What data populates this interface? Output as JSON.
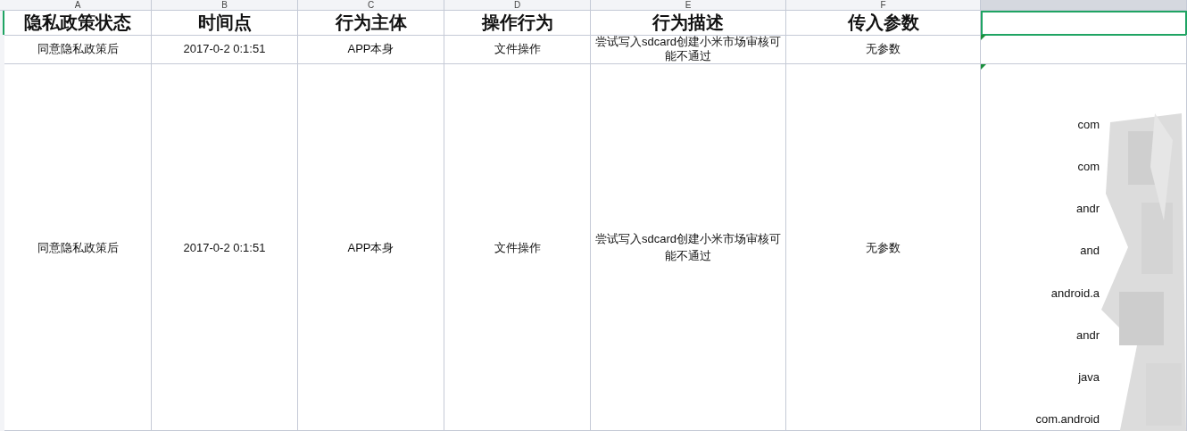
{
  "column_headers": [
    {
      "label": "A",
      "selected": false
    },
    {
      "label": "B",
      "selected": false
    },
    {
      "label": "C",
      "selected": false
    },
    {
      "label": "D",
      "selected": false
    },
    {
      "label": "E",
      "selected": false
    },
    {
      "label": "F",
      "selected": false
    },
    {
      "selected": true
    }
  ],
  "rows": [
    {
      "kind": "header",
      "cells": [
        {
          "text": "隐私政策状态",
          "selected": false
        },
        {
          "text": "时间点",
          "selected": false
        },
        {
          "text": "行为主体",
          "selected": false
        },
        {
          "text": "操作行为",
          "selected": false
        },
        {
          "text": "行为描述",
          "selected": false
        },
        {
          "text": "传入参数",
          "selected": false
        },
        {
          "selected": true
        }
      ]
    },
    {
      "kind": "data",
      "cells": [
        {
          "text": "同意隐私政策后",
          "selected": false
        },
        {
          "text": "2017-0-2 0:1:51",
          "selected": false
        },
        {
          "text": "APP本身",
          "selected": false
        },
        {
          "text": "文件操作",
          "selected": false
        },
        {
          "text": "尝试写入sdcard创建小米市场审核可能不通过",
          "selected": false
        },
        {
          "text": "无参数",
          "selected": false
        },
        {
          "selected": false,
          "note": true
        }
      ]
    },
    {
      "kind": "tall",
      "cells": [
        {
          "text": "同意隐私政策后",
          "selected": false
        },
        {
          "text": "2017-0-2 0:1:51",
          "selected": false
        },
        {
          "text": "APP本身",
          "selected": false
        },
        {
          "text": "文件操作",
          "selected": false
        },
        {
          "text": "尝试写入sdcard创建小米市场审核可能不通过",
          "selected": false
        },
        {
          "text": "无参数",
          "selected": false
        },
        {
          "selected": false,
          "note": true,
          "redacted": true,
          "lines": [
            "com",
            "com",
            "andr",
            "and",
            "android.a",
            "andr",
            "java",
            "com.android"
          ]
        }
      ]
    }
  ]
}
